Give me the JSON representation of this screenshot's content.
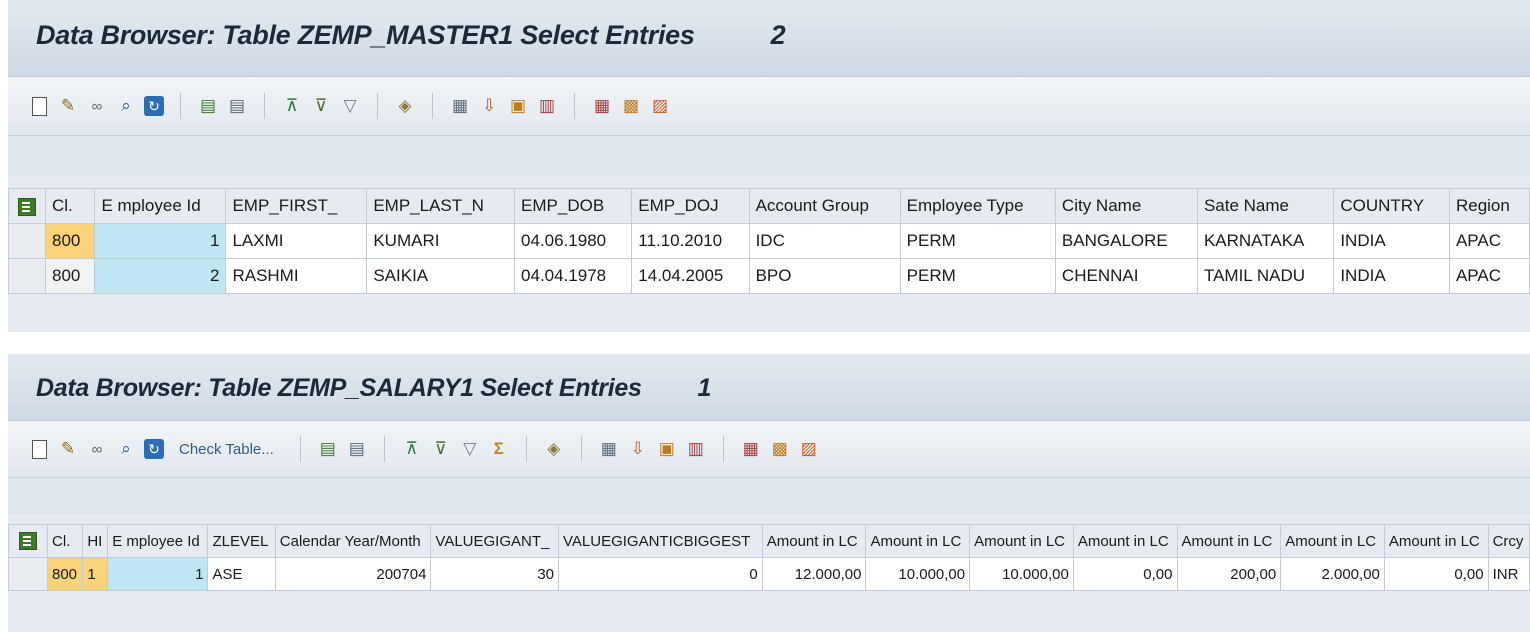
{
  "panel1": {
    "title": "Data Browser: Table ZEMP_MASTER1 Select Entries",
    "count": "2",
    "columns": [
      "Cl.",
      "E mployee Id",
      "EMP_FIRST_",
      "EMP_LAST_N",
      "EMP_DOB",
      "EMP_DOJ",
      "Account Group",
      "Employee Type",
      "City Name",
      "Sate Name",
      "COUNTRY",
      "Region"
    ],
    "rows": [
      [
        "800",
        "1",
        "LAXMI",
        "KUMARI",
        "04.06.1980",
        "11.10.2010",
        "IDC",
        "PERM",
        "BANGALORE",
        "KARNATAKA",
        "INDIA",
        "APAC"
      ],
      [
        "800",
        "2",
        "RASHMI",
        "SAIKIA",
        "04.04.1978",
        "14.04.2005",
        "BPO",
        "PERM",
        "CHENNAI",
        "TAMIL NADU",
        "INDIA",
        "APAC"
      ]
    ]
  },
  "panel2": {
    "title": "Data Browser: Table ZEMP_SALARY1 Select Entries",
    "count": "1",
    "check_table_label": "Check Table...",
    "columns": [
      "Cl.",
      "HI",
      "E mployee Id",
      "ZLEVEL",
      "Calendar Year/Month",
      "VALUEGIGANT_",
      "VALUEGIGANTICBIGGEST",
      "Amount in LC",
      "Amount in LC",
      "Amount in LC",
      "Amount in LC",
      "Amount in LC",
      "Amount in LC",
      "Amount in LC",
      "Crcy"
    ],
    "rows": [
      [
        "800",
        "1",
        "1",
        "ASE",
        "200704",
        "30",
        "0",
        "12.000,00",
        "10.000,00",
        "10.000,00",
        "0,00",
        "200,00",
        "2.000,00",
        "0,00",
        "INR"
      ]
    ]
  },
  "icons": {
    "doc": "document-icon",
    "edit": "pencil-icon",
    "display": "glasses-icon",
    "search": "search-icon",
    "refresh": "refresh-icon",
    "select_all": "select-all-icon",
    "deselect_all": "deselect-all-icon",
    "print": "print-icon",
    "filter": "filter-icon",
    "filter_off": "filter-off-icon",
    "sum": "sigma-icon",
    "details": "details-icon",
    "export": "export-icon",
    "import": "import-icon",
    "layout": "layout-icon",
    "grid": "grid-icon"
  },
  "colors": {
    "client_highlight": "#f9d27a",
    "key_column": "#bfe6f2",
    "panel_bg": "#dfe6ee"
  }
}
